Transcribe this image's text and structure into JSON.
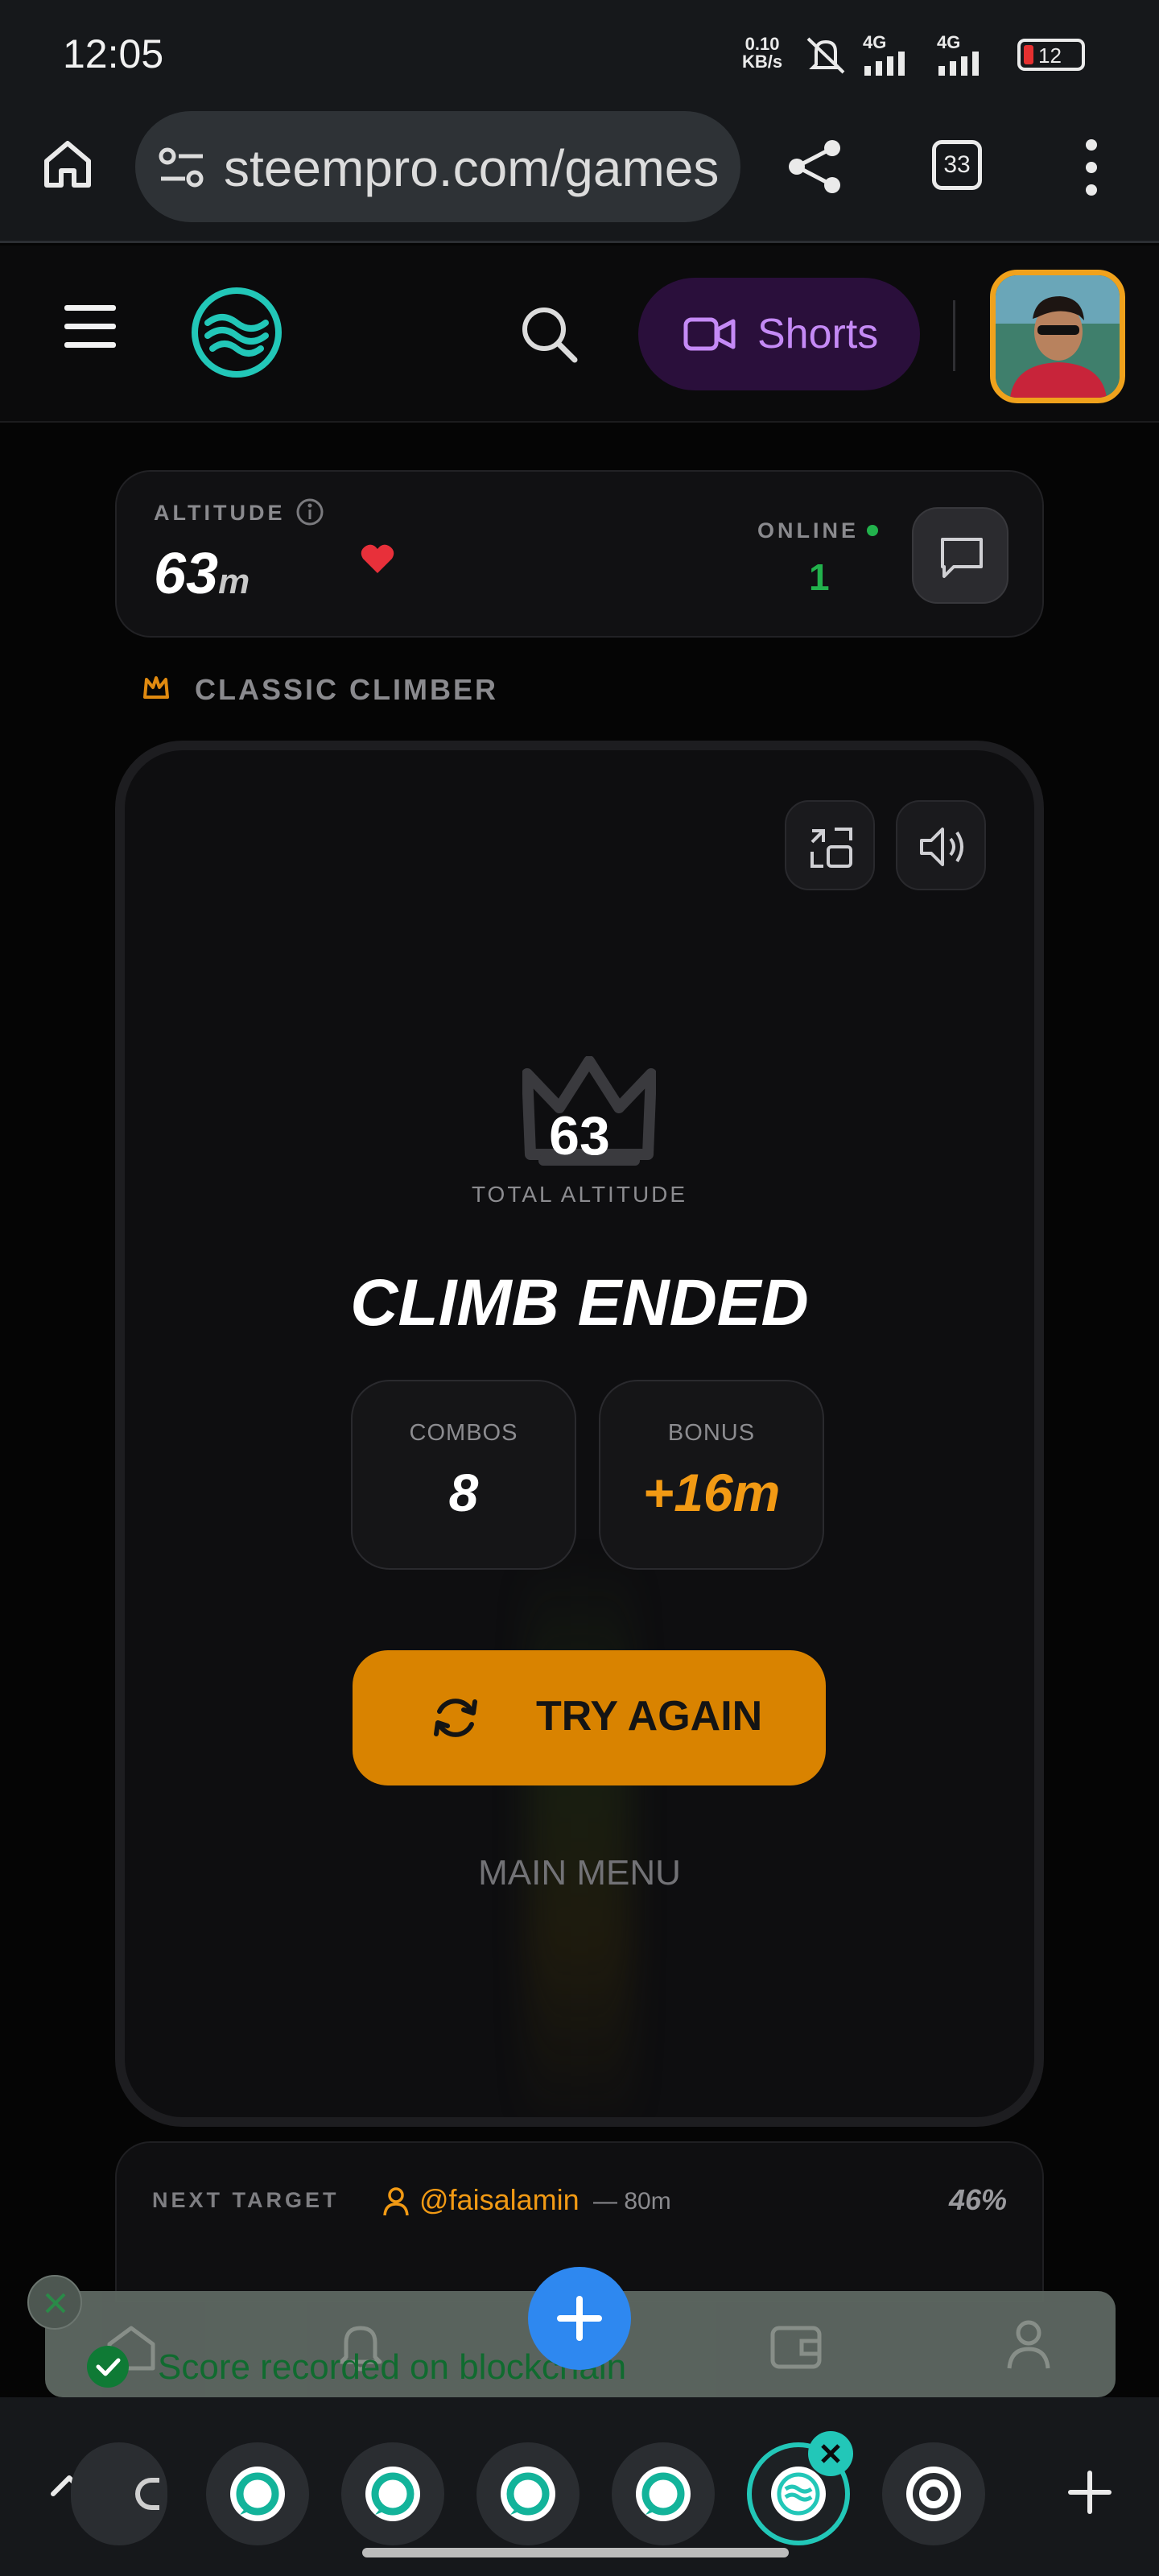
{
  "status_bar": {
    "time": "12:05",
    "net_speed_value": "0.10",
    "net_speed_unit": "KB/s",
    "signal_1": "4G",
    "signal_2": "4G",
    "battery": "12"
  },
  "browser": {
    "url": "steempro.com/games",
    "tab_count": "33"
  },
  "header": {
    "shorts_label": "Shorts"
  },
  "altitude_card": {
    "altitude_label": "ALTITUDE",
    "altitude_value": "63",
    "altitude_unit": "m",
    "online_label": "ONLINE",
    "online_count": "1"
  },
  "game": {
    "mode_label": "CLASSIC CLIMBER",
    "total_value": "63",
    "total_label": "TOTAL ALTITUDE",
    "headline": "CLIMB ENDED",
    "combos_label": "COMBOS",
    "combos_value": "8",
    "bonus_label": "BONUS",
    "bonus_value": "+16m",
    "try_again_label": "TRY AGAIN",
    "main_menu_label": "MAIN MENU"
  },
  "next_target": {
    "label": "NEXT TARGET",
    "user": "@faisalamin",
    "distance": "— 80m",
    "progress_text": "46%"
  },
  "toast": {
    "message": "Score recorded on blockchain"
  },
  "colors": {
    "accent_orange": "#d98300",
    "bonus_orange": "#f29a14",
    "online_green": "#22b24c",
    "shorts_purple": "#c58af6",
    "logo_teal": "#22c7b8"
  }
}
